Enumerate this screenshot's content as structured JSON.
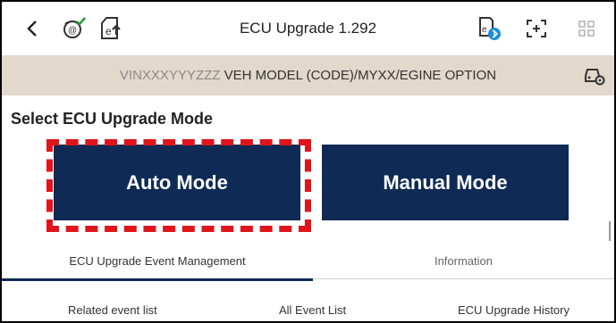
{
  "header": {
    "title": "ECU Upgrade 1.292",
    "icons": [
      "back-icon",
      "signal-check-icon",
      "document-upload-icon",
      "sd-card-bluetooth-icon",
      "screenshot-frame-icon",
      "grid-apps-icon"
    ]
  },
  "vehicle": {
    "vin": "VINXXXYYYZZZ",
    "info": " VEH MODEL (CODE)/MYXX/EGINE OPTION",
    "icon": "vehicle-settings-icon"
  },
  "section": {
    "heading": "Select ECU Upgrade Mode"
  },
  "modes": {
    "auto_label": "Auto Mode",
    "manual_label": "Manual Mode",
    "button_color": "#0f2a54",
    "highlight_color": "#e0141b"
  },
  "tabs": [
    {
      "label": "ECU Upgrade Event Management",
      "active": true
    },
    {
      "label": "Information",
      "active": false
    }
  ],
  "subtabs": [
    {
      "label": "Related event list"
    },
    {
      "label": "All Event List"
    },
    {
      "label": "ECU Upgrade History"
    }
  ]
}
